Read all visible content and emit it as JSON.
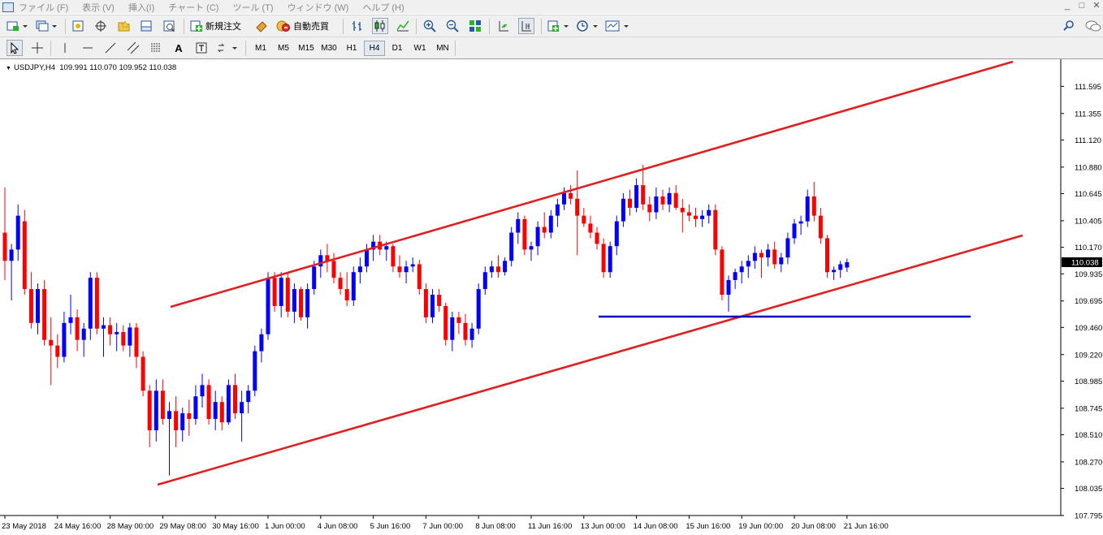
{
  "menu": {
    "items": [
      "ファイル (F)",
      "表示 (V)",
      "挿入(I)",
      "チャート (C)",
      "ツール (T)",
      "ウィンドウ (W)",
      "ヘルプ (H)"
    ],
    "window_controls": [
      "_",
      "□",
      "✕"
    ]
  },
  "toolbar": {
    "new_order_label": "新規注文",
    "auto_trade_label": "自動売買",
    "timeframes": [
      "M1",
      "M5",
      "M15",
      "M30",
      "H1",
      "H4",
      "D1",
      "W1",
      "MN"
    ],
    "active_timeframe": "H4",
    "text_tool_label": "A"
  },
  "chart_header": {
    "symbol": "USDJPY,H4",
    "ohlc": "109.991 110.070 109.952 110.038"
  },
  "colors": {
    "bull": "#0000ff",
    "bear": "#ff0000",
    "trendline": "#e02020",
    "support": "#0000c8",
    "price_box": "#000000"
  },
  "chart_data": {
    "type": "candlestick",
    "symbol": "USDJPY",
    "timeframe": "H4",
    "current_price": "110.038",
    "y_ticks": [
      "111.595",
      "111.355",
      "111.120",
      "110.880",
      "110.645",
      "110.405",
      "110.170",
      "109.935",
      "109.695",
      "109.460",
      "109.220",
      "108.985",
      "108.745",
      "108.510",
      "108.270",
      "108.035",
      "107.795"
    ],
    "ylim": [
      107.795,
      111.835
    ],
    "x_ticks": [
      "23 May 2018",
      "24 May 16:00",
      "28 May 00:00",
      "29 May 08:00",
      "30 May 16:00",
      "1 Jun 00:00",
      "4 Jun 08:00",
      "5 Jun 16:00",
      "7 Jun 00:00",
      "8 Jun 08:00",
      "11 Jun 16:00",
      "13 Jun 00:00",
      "14 Jun 08:00",
      "15 Jun 16:00",
      "19 Jun 00:00",
      "20 Jun 08:00",
      "21 Jun 16:00"
    ],
    "x_tick_bar_index": [
      0,
      8,
      16,
      24,
      32,
      40,
      48,
      56,
      64,
      72,
      80,
      88,
      96,
      104,
      112,
      120,
      128
    ],
    "candles": [
      [
        110.3,
        110.7,
        109.88,
        110.05
      ],
      [
        110.05,
        110.2,
        109.7,
        110.15
      ],
      [
        110.15,
        110.55,
        110.05,
        110.45
      ],
      [
        110.4,
        110.5,
        109.75,
        109.8
      ],
      [
        109.8,
        109.95,
        109.45,
        109.5
      ],
      [
        109.5,
        109.85,
        109.4,
        109.8
      ],
      [
        109.8,
        109.88,
        109.3,
        109.35
      ],
      [
        109.35,
        109.55,
        108.95,
        109.3
      ],
      [
        109.3,
        109.4,
        109.1,
        109.2
      ],
      [
        109.2,
        109.6,
        109.15,
        109.5
      ],
      [
        109.5,
        109.75,
        109.4,
        109.55
      ],
      [
        109.55,
        109.62,
        109.25,
        109.35
      ],
      [
        109.35,
        109.5,
        109.2,
        109.45
      ],
      [
        109.45,
        109.95,
        109.35,
        109.9
      ],
      [
        109.9,
        109.95,
        109.4,
        109.45
      ],
      [
        109.45,
        109.55,
        109.2,
        109.48
      ],
      [
        109.48,
        109.55,
        109.3,
        109.4
      ],
      [
        109.4,
        109.5,
        109.25,
        109.42
      ],
      [
        109.42,
        109.48,
        109.25,
        109.3
      ],
      [
        109.3,
        109.5,
        109.2,
        109.46
      ],
      [
        109.46,
        109.5,
        109.1,
        109.2
      ],
      [
        109.2,
        109.25,
        108.85,
        108.9
      ],
      [
        108.9,
        108.95,
        108.4,
        108.55
      ],
      [
        108.55,
        109.0,
        108.45,
        108.9
      ],
      [
        108.9,
        109.0,
        108.6,
        108.65
      ],
      [
        108.65,
        108.8,
        108.15,
        108.72
      ],
      [
        108.72,
        108.85,
        108.4,
        108.55
      ],
      [
        108.55,
        108.75,
        108.45,
        108.7
      ],
      [
        108.7,
        108.82,
        108.5,
        108.65
      ],
      [
        108.65,
        108.95,
        108.6,
        108.85
      ],
      [
        108.85,
        109.05,
        108.75,
        108.95
      ],
      [
        108.95,
        109.0,
        108.6,
        108.65
      ],
      [
        108.65,
        108.9,
        108.55,
        108.8
      ],
      [
        108.8,
        108.85,
        108.55,
        108.62
      ],
      [
        108.62,
        109.0,
        108.6,
        108.95
      ],
      [
        108.95,
        109.05,
        108.65,
        108.7
      ],
      [
        108.7,
        108.9,
        108.45,
        108.8
      ],
      [
        108.8,
        108.95,
        108.7,
        108.9
      ],
      [
        108.9,
        109.3,
        108.85,
        109.25
      ],
      [
        109.25,
        109.45,
        109.15,
        109.4
      ],
      [
        109.4,
        109.95,
        109.35,
        109.9
      ],
      [
        109.9,
        109.95,
        109.6,
        109.65
      ],
      [
        109.65,
        109.95,
        109.55,
        109.9
      ],
      [
        109.9,
        109.95,
        109.55,
        109.6
      ],
      [
        109.6,
        109.85,
        109.5,
        109.8
      ],
      [
        109.8,
        109.82,
        109.52,
        109.55
      ],
      [
        109.55,
        109.85,
        109.45,
        109.8
      ],
      [
        109.8,
        110.05,
        109.75,
        110.0
      ],
      [
        110.0,
        110.15,
        109.9,
        110.1
      ],
      [
        110.1,
        110.2,
        109.95,
        110.05
      ],
      [
        110.05,
        110.12,
        109.85,
        109.9
      ],
      [
        109.9,
        109.95,
        109.75,
        109.8
      ],
      [
        109.8,
        109.95,
        109.65,
        109.7
      ],
      [
        109.7,
        110.0,
        109.65,
        109.95
      ],
      [
        109.95,
        110.08,
        109.85,
        110.0
      ],
      [
        110.0,
        110.2,
        109.95,
        110.15
      ],
      [
        110.15,
        110.28,
        110.05,
        110.22
      ],
      [
        110.22,
        110.28,
        110.1,
        110.15
      ],
      [
        110.15,
        110.22,
        110.05,
        110.18
      ],
      [
        110.18,
        110.2,
        109.95,
        110.0
      ],
      [
        110.0,
        110.1,
        109.9,
        109.95
      ],
      [
        109.95,
        110.05,
        109.85,
        110.0
      ],
      [
        110.0,
        110.08,
        109.95,
        110.02
      ],
      [
        110.02,
        110.06,
        109.75,
        109.8
      ],
      [
        109.8,
        109.85,
        109.5,
        109.55
      ],
      [
        109.55,
        109.8,
        109.5,
        109.75
      ],
      [
        109.75,
        109.8,
        109.6,
        109.65
      ],
      [
        109.65,
        109.68,
        109.3,
        109.35
      ],
      [
        109.35,
        109.6,
        109.25,
        109.55
      ],
      [
        109.55,
        109.6,
        109.4,
        109.5
      ],
      [
        109.5,
        109.58,
        109.3,
        109.35
      ],
      [
        109.35,
        109.5,
        109.28,
        109.45
      ],
      [
        109.45,
        109.85,
        109.4,
        109.8
      ],
      [
        109.8,
        110.0,
        109.75,
        109.95
      ],
      [
        109.95,
        110.05,
        109.9,
        110.0
      ],
      [
        110.0,
        110.1,
        109.9,
        109.95
      ],
      [
        109.95,
        110.08,
        109.92,
        110.05
      ],
      [
        110.05,
        110.35,
        110.0,
        110.3
      ],
      [
        110.3,
        110.48,
        110.2,
        110.42
      ],
      [
        110.42,
        110.45,
        110.1,
        110.15
      ],
      [
        110.15,
        110.22,
        110.05,
        110.18
      ],
      [
        110.18,
        110.4,
        110.1,
        110.35
      ],
      [
        110.35,
        110.48,
        110.25,
        110.3
      ],
      [
        110.3,
        110.5,
        110.25,
        110.45
      ],
      [
        110.45,
        110.6,
        110.35,
        110.55
      ],
      [
        110.55,
        110.7,
        110.5,
        110.65
      ],
      [
        110.65,
        110.72,
        110.55,
        110.6
      ],
      [
        110.6,
        110.85,
        110.1,
        110.45
      ],
      [
        110.45,
        110.52,
        110.35,
        110.38
      ],
      [
        110.38,
        110.45,
        110.25,
        110.3
      ],
      [
        110.3,
        110.35,
        110.15,
        110.2
      ],
      [
        110.2,
        110.25,
        109.9,
        109.95
      ],
      [
        109.95,
        110.22,
        109.9,
        110.18
      ],
      [
        110.18,
        110.45,
        110.1,
        110.4
      ],
      [
        110.4,
        110.65,
        110.35,
        110.6
      ],
      [
        110.6,
        110.68,
        110.45,
        110.52
      ],
      [
        110.52,
        110.78,
        110.48,
        110.72
      ],
      [
        110.72,
        110.9,
        110.5,
        110.55
      ],
      [
        110.55,
        110.62,
        110.4,
        110.48
      ],
      [
        110.48,
        110.7,
        110.42,
        110.62
      ],
      [
        110.62,
        110.68,
        110.5,
        110.55
      ],
      [
        110.55,
        110.7,
        110.48,
        110.65
      ],
      [
        110.65,
        110.72,
        110.5,
        110.52
      ],
      [
        110.52,
        110.6,
        110.3,
        110.48
      ],
      [
        110.48,
        110.55,
        110.4,
        110.45
      ],
      [
        110.45,
        110.52,
        110.35,
        110.42
      ],
      [
        110.42,
        110.5,
        110.35,
        110.45
      ],
      [
        110.45,
        110.55,
        110.38,
        110.5
      ],
      [
        110.5,
        110.55,
        110.1,
        110.15
      ],
      [
        110.15,
        110.18,
        109.7,
        109.75
      ],
      [
        109.75,
        109.92,
        109.6,
        109.88
      ],
      [
        109.88,
        109.98,
        109.8,
        109.95
      ],
      [
        109.95,
        110.05,
        109.85,
        110.0
      ],
      [
        110.0,
        110.1,
        109.9,
        110.05
      ],
      [
        110.05,
        110.18,
        109.98,
        110.12
      ],
      [
        110.12,
        110.15,
        109.9,
        110.08
      ],
      [
        110.08,
        110.2,
        110.0,
        110.15
      ],
      [
        110.15,
        110.22,
        109.98,
        110.02
      ],
      [
        110.02,
        110.12,
        109.95,
        110.08
      ],
      [
        110.08,
        110.3,
        110.02,
        110.25
      ],
      [
        110.25,
        110.42,
        110.2,
        110.38
      ],
      [
        110.38,
        110.45,
        110.28,
        110.4
      ],
      [
        110.4,
        110.68,
        110.35,
        110.62
      ],
      [
        110.62,
        110.75,
        110.4,
        110.45
      ],
      [
        110.45,
        110.52,
        110.2,
        110.25
      ],
      [
        110.25,
        110.28,
        109.9,
        109.95
      ],
      [
        109.95,
        110.0,
        109.88,
        109.97
      ],
      [
        109.97,
        110.05,
        109.9,
        110.02
      ],
      [
        109.991,
        110.07,
        109.952,
        110.038
      ]
    ]
  }
}
